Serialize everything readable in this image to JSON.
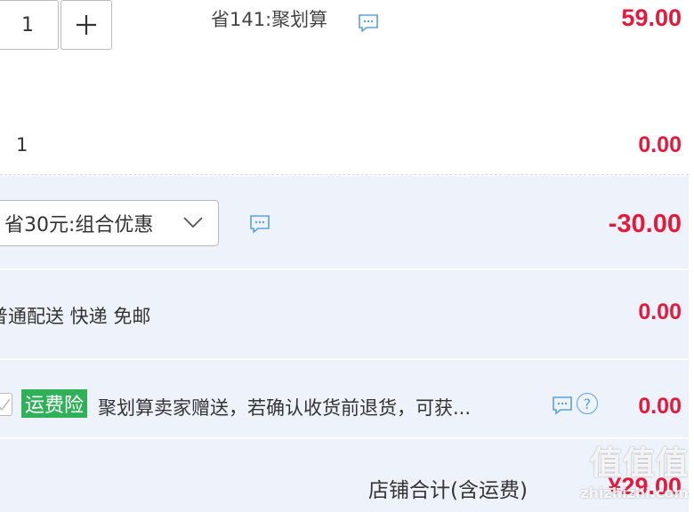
{
  "item": {
    "quantity": "1",
    "plus_symbol": "+",
    "promo_text": "省141:聚划算",
    "price": "59.00"
  },
  "gift_row": {
    "quantity": "1",
    "price": "0.00"
  },
  "discount": {
    "selected": "省30元:组合优惠",
    "amount": "-30.00"
  },
  "shipping": {
    "text": "普通配送 快递 免邮",
    "price": "0.00"
  },
  "insurance": {
    "badge": "运费险",
    "text": "聚划算卖家赠送，若确认收货前退货，可获...",
    "price": "0.00",
    "help_symbol": "?"
  },
  "total": {
    "label": "店铺合计(含运费)",
    "amount": "¥29.00"
  },
  "watermark": {
    "logo_text": "值值值",
    "url_text": "zhizhizhi.com"
  },
  "colors": {
    "price_red": "#e5193b",
    "band_blue": "#eef3fb",
    "icon_blue": "#5aa0df",
    "badge_green": "#31b05a"
  }
}
